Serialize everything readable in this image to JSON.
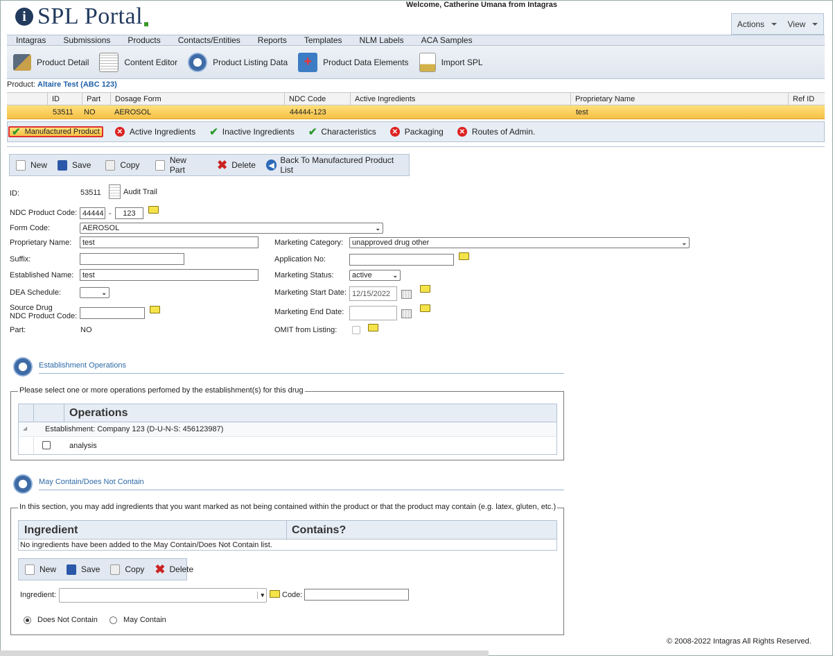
{
  "header": {
    "logo_text": "SPL Portal",
    "logo_glyph": "i",
    "welcome": "Welcome, Catherine Umana from Intagras",
    "actions_label": "Actions",
    "view_label": "View"
  },
  "menu": [
    "Intagras",
    "Submissions",
    "Products",
    "Contacts/Entities",
    "Reports",
    "Templates",
    "NLM Labels",
    "ACA Samples"
  ],
  "toolbar": [
    "Product Detail",
    "Content Editor",
    "Product Listing Data",
    "Product Data Elements",
    "Import SPL"
  ],
  "product": {
    "label": "Product:",
    "name": "Altaire Test (ABC 123)"
  },
  "grid": {
    "headers": [
      "ID",
      "Part",
      "Dosage Form",
      "NDC Code",
      "Active Ingredients",
      "Proprietary Name",
      "Ref ID"
    ],
    "row": [
      "53511",
      "NO",
      "AEROSOL",
      "44444-123",
      "",
      "test",
      ""
    ]
  },
  "tabs": [
    {
      "label": "Manufactured Product",
      "status": "ok"
    },
    {
      "label": "Active Ingredients",
      "status": "error"
    },
    {
      "label": "Inactive Ingredients",
      "status": "ok"
    },
    {
      "label": "Characteristics",
      "status": "ok"
    },
    {
      "label": "Packaging",
      "status": "error"
    },
    {
      "label": "Routes of Admin.",
      "status": "error"
    }
  ],
  "actions": [
    "New",
    "Save",
    "Copy",
    "New Part",
    "Delete",
    "Back To Manufactured Product List"
  ],
  "form": {
    "id_label": "ID:",
    "id_value": "53511",
    "audit_trail": "Audit Trail",
    "ndc_label": "NDC Product Code:",
    "ndc_a": "44444",
    "ndc_sep": "-",
    "ndc_b": "123",
    "form_code_label": "Form Code:",
    "form_code": "AEROSOL",
    "prop_name_label": "Proprietary Name:",
    "prop_name": "test",
    "suffix_label": "Suffix:",
    "suffix": "",
    "est_name_label": "Established Name:",
    "est_name": "test",
    "dea_label": "DEA Schedule:",
    "dea": "",
    "source_label_1": "Source Drug",
    "source_label_2": "NDC Product Code:",
    "source": "",
    "part_label": "Part:",
    "part": "NO",
    "mkt_cat_label": "Marketing Category:",
    "mkt_cat": "unapproved drug other",
    "app_no_label": "Application No:",
    "app_no": "",
    "mkt_status_label": "Marketing Status:",
    "mkt_status": "active",
    "mkt_start_label": "Marketing Start Date:",
    "mkt_start": "12/15/2022",
    "mkt_end_label": "Marketing End Date:",
    "mkt_end": "",
    "omit_label": "OMIT from Listing:"
  },
  "establishment": {
    "title": "Establishment Operations",
    "legend": "Please select one or more operations perfomed by the establishment(s) for this drug",
    "col": "Operations",
    "group": "Establishment: Company 123 (D-U-N-S: 456123987)",
    "item": "analysis"
  },
  "maycontain": {
    "title": "May Contain/Does Not Contain",
    "legend": "In this section, you may add ingredients that you want marked as not being contained within the product or that the product may contain (e.g. latex, gluten, etc.)",
    "col1": "Ingredient",
    "col2": "Contains?",
    "empty": "No ingredients have been added to the May Contain/Does Not Contain list.",
    "actions": [
      "New",
      "Save",
      "Copy",
      "Delete"
    ],
    "ingredient_label": "Ingredient:",
    "code_label": "Code:",
    "radio1": "Does Not Contain",
    "radio2": "May Contain"
  },
  "footer": "© 2008-2022 Intagras All Rights Reserved.",
  "colors": {
    "brand": "#223a5e",
    "accent": "#1f5fa8",
    "selected_row": "#f5c046",
    "error": "#dd2222",
    "ok": "#2a9a2a"
  }
}
